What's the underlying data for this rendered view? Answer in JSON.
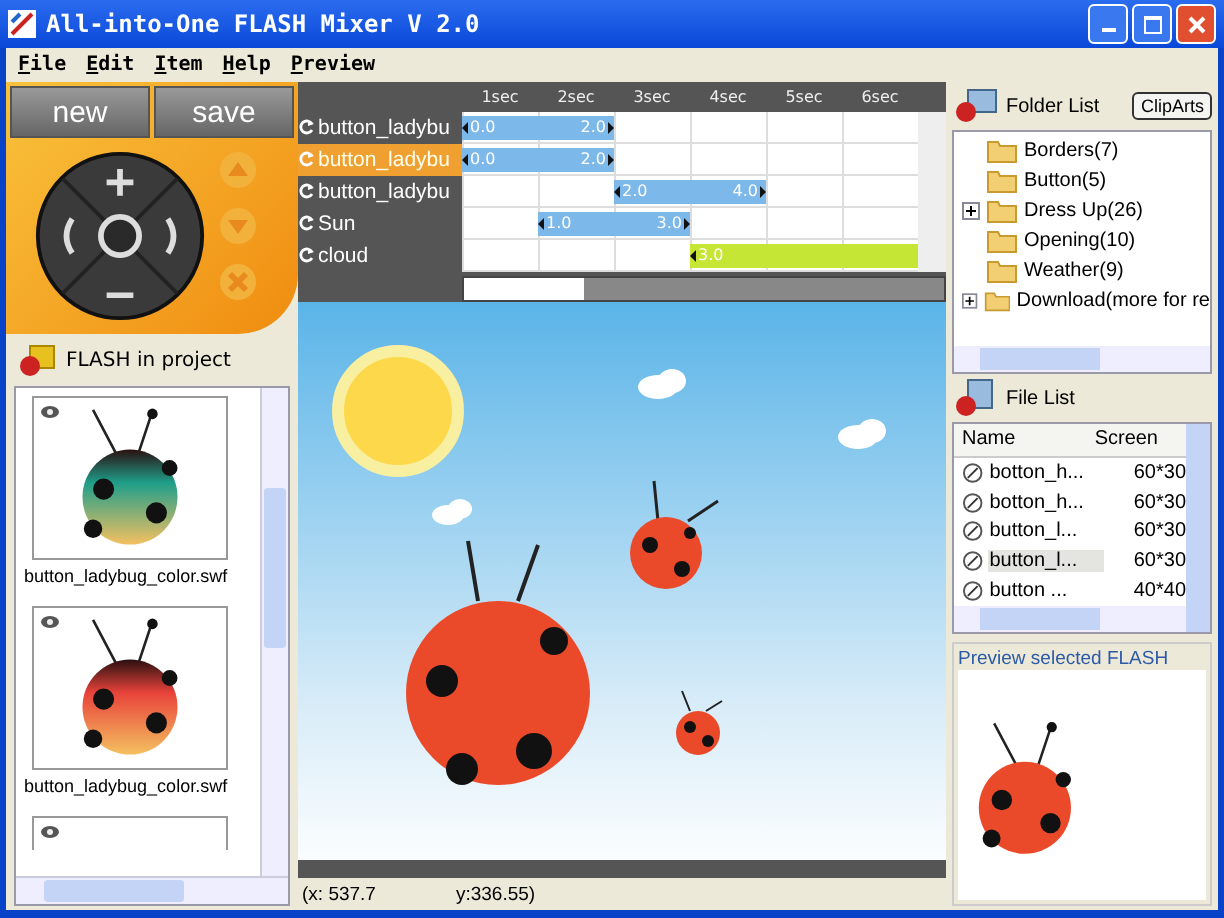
{
  "window": {
    "title": "All-into-One FLASH Mixer V 2.0"
  },
  "menu": [
    "File",
    "Edit",
    "Item",
    "Help",
    "Preview"
  ],
  "controls": {
    "buttons": [
      "new",
      "save"
    ]
  },
  "project": {
    "title": "FLASH in project",
    "items": [
      {
        "caption": "button_ladybug_color.swf",
        "color": "#1f9e8a"
      },
      {
        "caption": "button_ladybug_color.swf",
        "color": "#e8433a"
      }
    ]
  },
  "timeline": {
    "ticks": [
      "1sec",
      "2sec",
      "3sec",
      "4sec",
      "5sec",
      "6sec"
    ],
    "tracks": [
      {
        "name": "button_ladybu",
        "selected": false,
        "start": "0.0",
        "end": "2.0",
        "color": "#7cb8ea"
      },
      {
        "name": "button_ladybu",
        "selected": true,
        "start": "0.0",
        "end": "2.0",
        "color": "#7cb8ea"
      },
      {
        "name": "button_ladybu",
        "selected": false,
        "start": "2.0",
        "end": "4.0",
        "color": "#7cb8ea"
      },
      {
        "name": "Sun",
        "selected": false,
        "start": "1.0",
        "end": "3.0",
        "color": "#7cb8ea"
      },
      {
        "name": "cloud",
        "selected": false,
        "start": "3.0",
        "color": "#c6e635"
      }
    ]
  },
  "folders": {
    "title": "Folder List",
    "button": "ClipArts",
    "items": [
      {
        "label": "Borders(7)",
        "kind": "leaf"
      },
      {
        "label": "Button(5)",
        "kind": "leaf"
      },
      {
        "label": "Dress Up(26)",
        "kind": "branch",
        "expanded": false
      },
      {
        "label": "Opening(10)",
        "kind": "leaf"
      },
      {
        "label": "Weather(9)",
        "kind": "leaf"
      },
      {
        "label": "Download(more for re",
        "kind": "branch",
        "expanded": false
      }
    ]
  },
  "files": {
    "title": "File List",
    "columns": [
      "Name",
      "Screen"
    ],
    "rows": [
      {
        "name": "botton_h...",
        "screen": "60*30",
        "selected": false
      },
      {
        "name": "botton_h...",
        "screen": "60*30",
        "selected": false
      },
      {
        "name": "button_l...",
        "screen": "60*30",
        "selected": false
      },
      {
        "name": "button_l...",
        "screen": "60*30",
        "selected": true
      },
      {
        "name": "button ...",
        "screen": "40*40",
        "selected": false
      }
    ]
  },
  "preview": {
    "title": "Preview selected FLASH"
  },
  "status_bar": {
    "x": "(x: 537.7",
    "y": "y:336.55)"
  }
}
